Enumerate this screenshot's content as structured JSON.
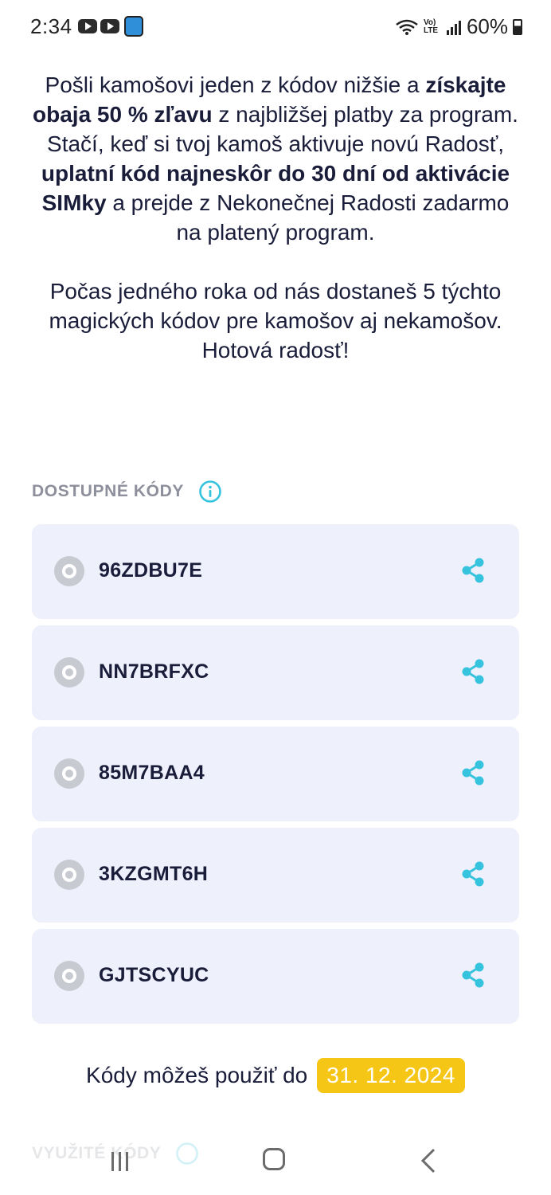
{
  "status_bar": {
    "time": "2:34",
    "battery": "60%",
    "network_label": "Vo) LTE"
  },
  "intro": {
    "p1_a": "Pošli kamošovi jeden z kódov nižšie a ",
    "p1_b": "získajte obaja 50 % zľavu",
    "p1_c": " z najbližšej platby za program. Stačí, keď si tvoj kamoš aktivuje novú Radosť, ",
    "p1_d": "uplatní kód najneskôr do 30 dní od aktivácie SIMky",
    "p1_e": " a prejde z Nekonečnej Radosti zadarmo na platený program.",
    "p2": "Počas jedného roka od nás dostaneš 5 týchto magických kódov pre kamošov aj nekamošov. Hotová radosť!"
  },
  "available": {
    "title": "DOSTUPNÉ KÓDY",
    "codes": [
      {
        "code": "96ZDBU7E"
      },
      {
        "code": "NN7BRFXC"
      },
      {
        "code": "85M7BAA4"
      },
      {
        "code": "3KZGMT6H"
      },
      {
        "code": "GJTSCYUC"
      }
    ]
  },
  "validity": {
    "label": "Kódy môžeš použiť do",
    "date": "31. 12. 2024"
  },
  "used": {
    "title": "VYUŽITÉ KÓDY"
  },
  "colors": {
    "accent": "#36c3dd",
    "highlight": "#f6c616",
    "card_bg": "#eef0fb",
    "text": "#1a1d3a"
  }
}
